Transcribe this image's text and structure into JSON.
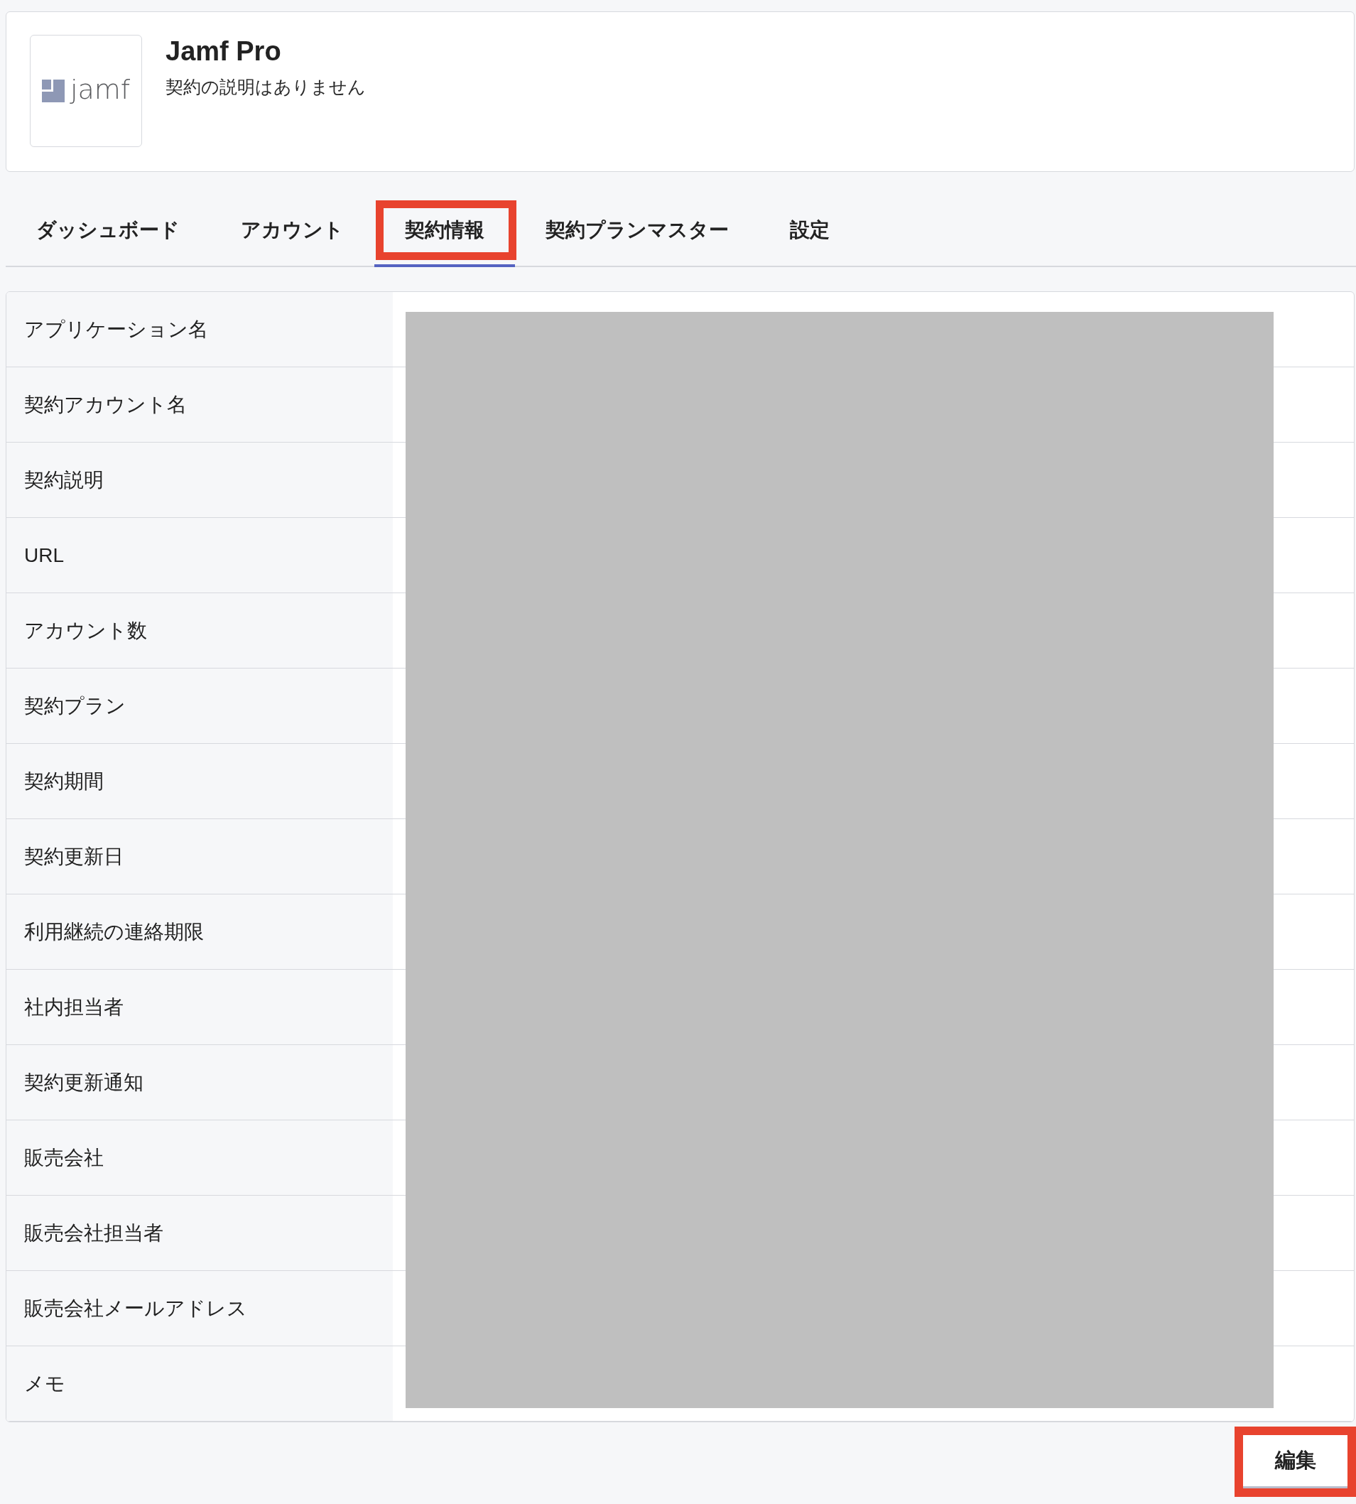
{
  "app": {
    "logo": {
      "text": "jamf"
    },
    "title": "Jamf Pro",
    "description": "契約の説明はありません"
  },
  "tabs": [
    {
      "label": "ダッシュボード",
      "selected": false,
      "highlighted": false
    },
    {
      "label": "アカウント",
      "selected": false,
      "highlighted": false
    },
    {
      "label": "契約情報",
      "selected": true,
      "highlighted": true
    },
    {
      "label": "契約プランマスター",
      "selected": false,
      "highlighted": false
    },
    {
      "label": "設定",
      "selected": false,
      "highlighted": false
    }
  ],
  "details": {
    "values_redacted": true,
    "rows": [
      {
        "label": "アプリケーション名"
      },
      {
        "label": "契約アカウント名"
      },
      {
        "label": "契約説明"
      },
      {
        "label": "URL"
      },
      {
        "label": "アカウント数"
      },
      {
        "label": "契約プラン"
      },
      {
        "label": "契約期間"
      },
      {
        "label": "契約更新日"
      },
      {
        "label": "利用継続の連絡期限"
      },
      {
        "label": "社内担当者"
      },
      {
        "label": "契約更新通知"
      },
      {
        "label": "販売会社"
      },
      {
        "label": "販売会社担当者"
      },
      {
        "label": "販売会社メールアドレス"
      },
      {
        "label": "メモ"
      }
    ]
  },
  "buttons": [
    {
      "label": "編集",
      "highlighted": true
    }
  ]
}
